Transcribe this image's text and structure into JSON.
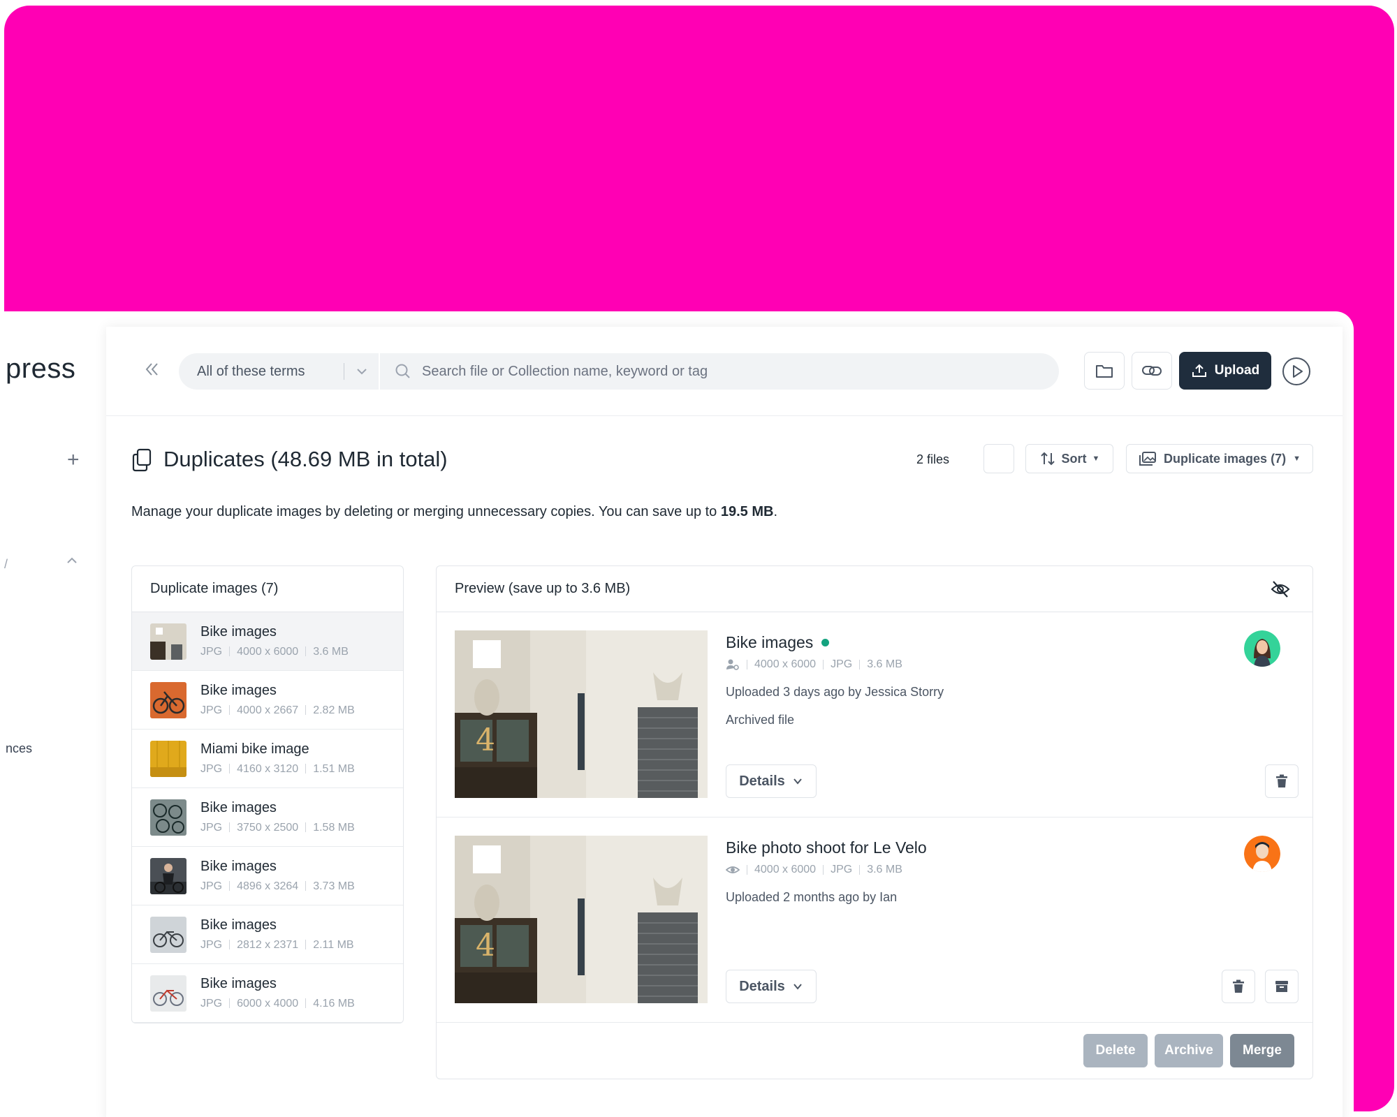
{
  "sidebar": {
    "brand": "press",
    "add_symbol": "+",
    "cut_label": "/",
    "cut_item": "nces"
  },
  "topbar": {
    "search_mode": "All of these terms",
    "search_placeholder": "Search file or Collection name, keyword or tag",
    "upload_label": "Upload"
  },
  "header": {
    "title": "Duplicates (48.69 MB in total)",
    "files_count": "2 files",
    "sort_label": "Sort",
    "filter_label": "Duplicate images (7)"
  },
  "description": {
    "text": "Manage your duplicate images by deleting or merging unnecessary copies. You can save up to ",
    "highlight": "19.5 MB",
    "suffix": "."
  },
  "list": {
    "title": "Duplicate images (7)",
    "items": [
      {
        "name": "Bike images",
        "format": "JPG",
        "dims": "4000 x 6000",
        "size": "3.6 MB",
        "thumb": "building"
      },
      {
        "name": "Bike images",
        "format": "JPG",
        "dims": "4000 x 2667",
        "size": "2.82 MB",
        "thumb": "orange-bike"
      },
      {
        "name": "Miami bike image",
        "format": "JPG",
        "dims": "4160 x 3120",
        "size": "1.51 MB",
        "thumb": "yellow-wall"
      },
      {
        "name": "Bike images",
        "format": "JPG",
        "dims": "3750 x 2500",
        "size": "1.58 MB",
        "thumb": "bikes-top"
      },
      {
        "name": "Bike images",
        "format": "JPG",
        "dims": "4896 x 3264",
        "size": "3.73 MB",
        "thumb": "rider"
      },
      {
        "name": "Bike images",
        "format": "JPG",
        "dims": "2812 x 2371",
        "size": "2.11 MB",
        "thumb": "bike-grey"
      },
      {
        "name": "Bike images",
        "format": "JPG",
        "dims": "6000 x 4000",
        "size": "4.16 MB",
        "thumb": "bike-red"
      }
    ]
  },
  "preview": {
    "title": "Preview (save up to 3.6 MB)",
    "files": [
      {
        "name": "Bike images",
        "dims": "4000 x 6000",
        "format": "JPG",
        "size": "3.6 MB",
        "uploaded": "Uploaded 3 days ago by Jessica Storry",
        "status": "Archived file",
        "details_label": "Details",
        "avatar_color": "#34d399"
      },
      {
        "name": "Bike photo shoot for Le Velo",
        "dims": "4000 x 6000",
        "format": "JPG",
        "size": "3.6 MB",
        "uploaded": "Uploaded 2 months ago by Ian",
        "details_label": "Details",
        "avatar_color": "#f97316"
      }
    ],
    "actions": {
      "delete": "Delete",
      "archive": "Archive",
      "merge": "Merge"
    }
  },
  "colors": {
    "accent_bg": "#ff00b4",
    "primary_button": "#1f2d3d",
    "online_dot": "#14a37f"
  }
}
